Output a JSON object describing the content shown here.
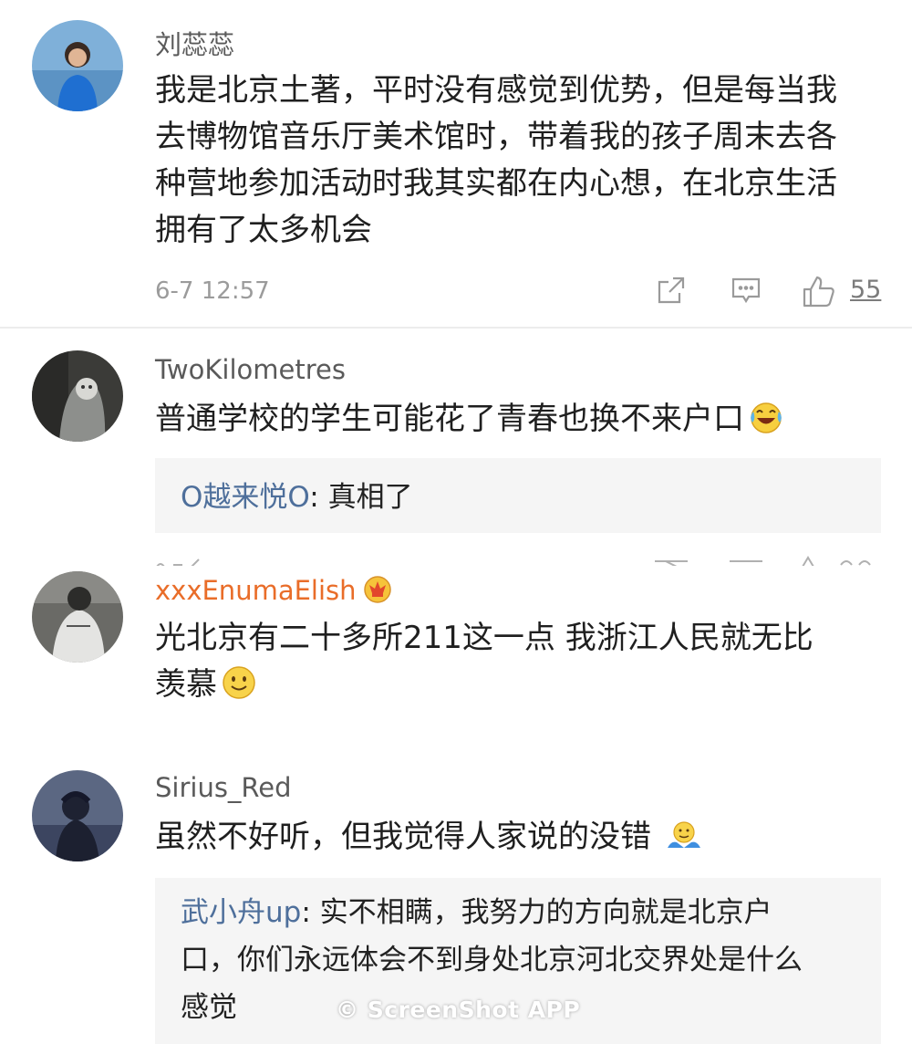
{
  "comments": [
    {
      "username": "刘蕊蕊",
      "lines": [
        "我是北京土著，平时没有感觉到优势，但是每当我",
        "去博物馆音乐厅美术馆时，带着我的孩子周末去各",
        "种营地参加活动时我其实都在内心想，在北京生活",
        "拥有了太多机会"
      ],
      "timestamp": "6-7 12:57",
      "likes": "55"
    },
    {
      "username": "TwoKilometres",
      "text": "普通学校的学生可能花了青春也换不来户口",
      "reply": {
        "author": "O越来悦O",
        "text": ": 真相了"
      },
      "emoji": "laugh-cry-emoji"
    },
    {
      "username": "xxxEnumaElish",
      "badge": "crown-badge-icon",
      "lines": [
        "光北京有二十多所211这一点  我浙江人民就无比",
        "羡慕"
      ],
      "emoji": "smile-emoji"
    },
    {
      "username": "Sirius_Red",
      "text": "虽然不好听，但我觉得人家说的没错",
      "emoji": "shrug-emoji",
      "reply": {
        "author": "武小舟up",
        "lines": [
          ": 实不相瞒，我努力的方向就是北京户",
          "口，你们永远体会不到身处北京河北交界处是什么",
          "感觉"
        ]
      }
    }
  ],
  "icons": {
    "share": "share-icon",
    "comment": "comment-icon",
    "like": "thumbs-up-icon"
  },
  "watermark": "© ScreenShot APP",
  "colors": {
    "username": "#5a5a5a",
    "vip_username": "#e96d29",
    "reply_author": "#4e6f9b",
    "reply_bg": "#f5f5f5"
  }
}
